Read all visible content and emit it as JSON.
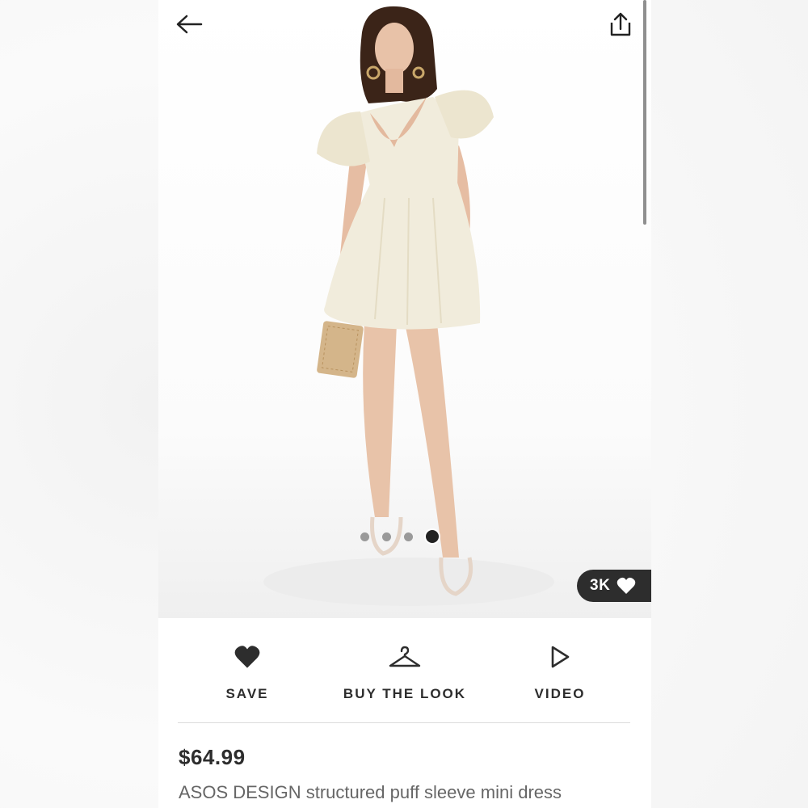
{
  "product": {
    "image_alt": "Model wearing cream puff sleeve mini dress",
    "likes_count": "3K",
    "carousel": {
      "total": 4,
      "active_index": 3
    },
    "price": "$64.99",
    "name": "ASOS DESIGN structured puff sleeve mini dress"
  },
  "toolbar": {
    "back_icon": "arrow-left-icon",
    "share_icon": "share-icon"
  },
  "actions": {
    "save_label": "SAVE",
    "buy_the_look_label": "BUY THE LOOK",
    "video_label": "VIDEO"
  },
  "colors": {
    "badge_bg": "#2d2d2d",
    "text_primary": "#2d2d2d",
    "text_secondary": "#666666",
    "dress": "#f1ecdc"
  }
}
